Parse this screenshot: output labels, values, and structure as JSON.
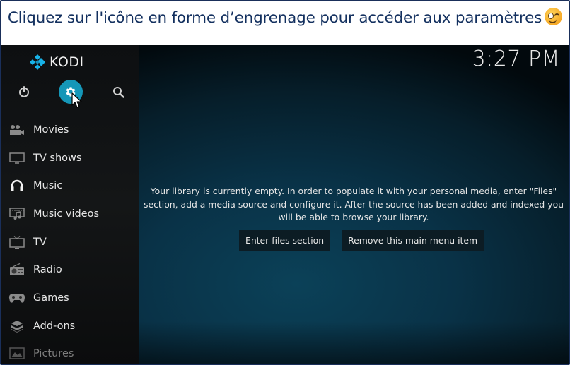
{
  "banner": {
    "text": "Cliquez sur l'icône en forme d’engrenage pour accéder aux paramètres",
    "emoji": "winking-face"
  },
  "app": {
    "name": "KODI",
    "clock": "3:27 PM",
    "accent_color": "#1597b8"
  },
  "top_icons": [
    {
      "name": "power",
      "label": "Power"
    },
    {
      "name": "settings",
      "label": "Settings",
      "selected": true
    },
    {
      "name": "search",
      "label": "Search"
    }
  ],
  "menu": {
    "items": [
      {
        "label": "Movies",
        "icon": "movie-camera-icon"
      },
      {
        "label": "TV shows",
        "icon": "tv-monitor-icon"
      },
      {
        "label": "Music",
        "icon": "headphones-icon"
      },
      {
        "label": "Music videos",
        "icon": "music-video-icon"
      },
      {
        "label": "TV",
        "icon": "tv-antenna-icon"
      },
      {
        "label": "Radio",
        "icon": "radio-icon"
      },
      {
        "label": "Games",
        "icon": "gamepad-icon"
      },
      {
        "label": "Add-ons",
        "icon": "addons-box-icon"
      },
      {
        "label": "Pictures",
        "icon": "pictures-icon"
      }
    ]
  },
  "main": {
    "message": "Your library is currently empty. In order to populate it with your personal media, enter \"Files\" section, add a media source and configure it. After the source has been added and indexed you will be able to browse your library.",
    "buttons": {
      "enter_files": "Enter files section",
      "remove_item": "Remove this main menu item"
    }
  }
}
